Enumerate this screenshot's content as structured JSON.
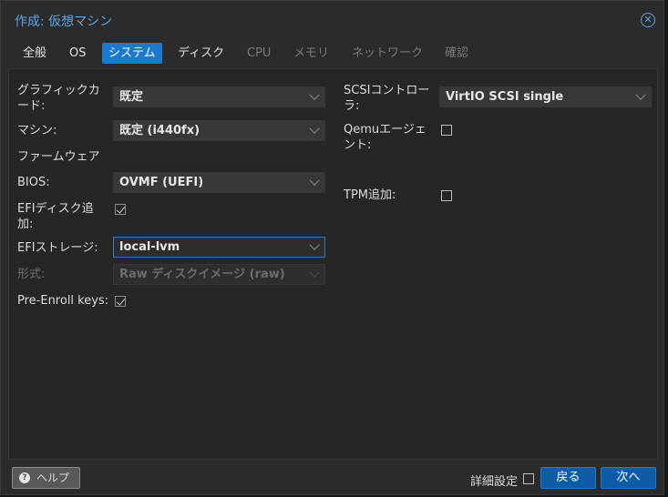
{
  "dialog": {
    "title": "作成: 仮想マシン"
  },
  "tabs": [
    {
      "label": "全般",
      "state": "normal"
    },
    {
      "label": "OS",
      "state": "normal"
    },
    {
      "label": "システム",
      "state": "active"
    },
    {
      "label": "ディスク",
      "state": "normal"
    },
    {
      "label": "CPU",
      "state": "disabled"
    },
    {
      "label": "メモリ",
      "state": "disabled"
    },
    {
      "label": "ネットワーク",
      "state": "disabled"
    },
    {
      "label": "確認",
      "state": "disabled"
    }
  ],
  "left": {
    "graphics": {
      "label_line1": "グラフィックカ",
      "label_line2": "ード:",
      "value": "既定"
    },
    "machine": {
      "label": "マシン:",
      "value": "既定 (i440fx)"
    },
    "firmware_header": "ファームウェア",
    "bios": {
      "label": "BIOS:",
      "value": "OVMF (UEFI)"
    },
    "efi_disk": {
      "label_line1": "EFIディスク追",
      "label_line2": "加:",
      "checked": true
    },
    "efi_storage": {
      "label": "EFIストレージ:",
      "value": "local-lvm"
    },
    "format": {
      "label": "形式:",
      "value": "Raw ディスクイメージ (raw)",
      "disabled": true
    },
    "pre_enroll": {
      "label": "Pre-Enroll keys:",
      "checked": true
    }
  },
  "right": {
    "scsi": {
      "label_line1": "SCSIコントロー",
      "label_line2": "ラ:",
      "value": "VirtIO SCSI single"
    },
    "qemu_agent": {
      "label_line1": "Qemuエージェ",
      "label_line2": "ント:",
      "checked": false
    },
    "tpm": {
      "label": "TPM追加:",
      "checked": false
    }
  },
  "footer": {
    "help_label": "ヘルプ",
    "advanced_label": "詳細設定",
    "advanced_checked": false,
    "back_label": "戻る",
    "next_label": "次へ"
  },
  "colors": {
    "accent": "#1a7ad0",
    "title": "#5aa6e6",
    "background": "#2b2b2b"
  }
}
